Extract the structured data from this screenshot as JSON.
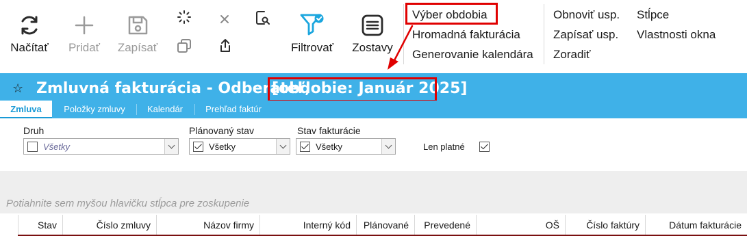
{
  "toolbar": {
    "reload_label": "Načítať",
    "add_label": "Pridať",
    "save_label": "Zapísať",
    "filter_label": "Filtrovať",
    "reports_label": "Zostavy"
  },
  "menu": {
    "col1": [
      "Výber obdobia",
      "Hromadná fakturácia",
      "Generovanie kalendára"
    ],
    "col2": [
      "Obnoviť usp.",
      "Zapísať usp.",
      "Zoradiť"
    ],
    "col3": [
      "Stĺpce",
      "Vlastnosti okna"
    ]
  },
  "title": {
    "main": "Zmluvná fakturácia - Odberateľ,",
    "period": "[obdobie: Január 2025]"
  },
  "tabs": [
    "Zmluva",
    "Položky zmluvy",
    "Kalendár",
    "Prehľad faktúr"
  ],
  "filters": {
    "druh_label": "Druh",
    "druh_value": "Všetky",
    "planned_label": "Plánovaný stav",
    "planned_value": "Všetky",
    "invoice_label": "Stav fakturácie",
    "invoice_value": "Všetky",
    "valid_only_label": "Len platné"
  },
  "group_hint": "Potiahnite sem myšou hlavičku stĺpca pre zoskupenie",
  "columns": [
    "Stav",
    "Číslo zmluvy",
    "Názov firmy",
    "Interný kód",
    "Plánované",
    "Prevedené",
    "OŠ",
    "Číslo faktúry",
    "Dátum fakturácie"
  ],
  "colors": {
    "accent": "#3fb1e8",
    "highlight": "#e00000",
    "filter_icon": "#1ba6de"
  }
}
